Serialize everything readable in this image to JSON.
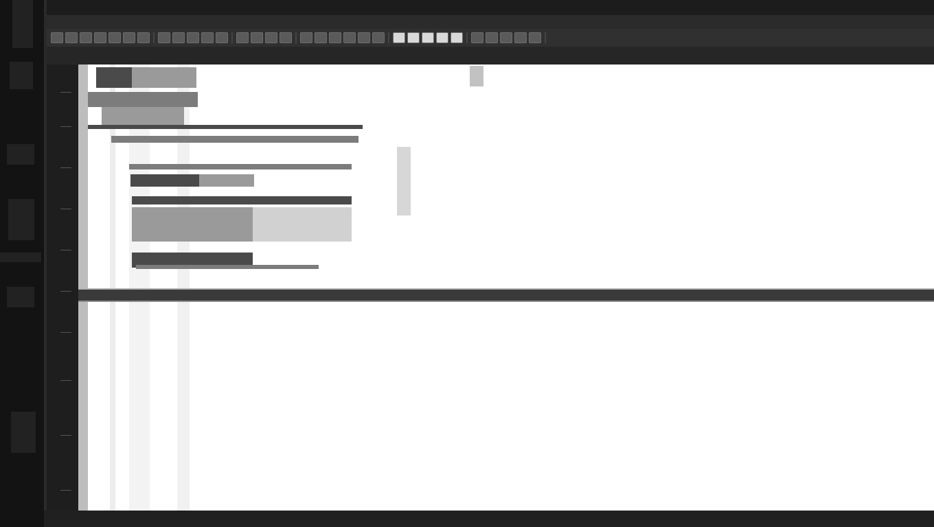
{
  "menu": [],
  "toolbar": {
    "groups": [
      [
        "new-icon",
        "open-icon",
        "save-icon",
        "save-as-icon",
        "edit-icon",
        "draw-icon",
        "brush-icon"
      ],
      [
        "undo-icon",
        "redo-icon",
        "cut-icon",
        "copy-icon",
        "paste-icon"
      ],
      [
        "zoom-in-icon",
        "zoom-out-icon",
        "hand-icon",
        "select-icon"
      ],
      [
        "grid-icon",
        "snap-icon",
        "layer-icon",
        "export-icon",
        "print-icon",
        "settings-icon"
      ],
      [
        "square-icon",
        "rect-icon",
        "frame-icon",
        "window-icon",
        "crop-icon"
      ],
      [
        "text-icon",
        "info-icon",
        "help-icon",
        "tool-icon",
        "pin-icon"
      ]
    ]
  },
  "tabs": [],
  "statusbar": {
    "items": []
  },
  "colors": {
    "background": "#0d0d0d",
    "menubar": "#2b2b2b",
    "toolbar": "#303030",
    "document": "#ffffff",
    "divider": "#3a3a3a"
  }
}
